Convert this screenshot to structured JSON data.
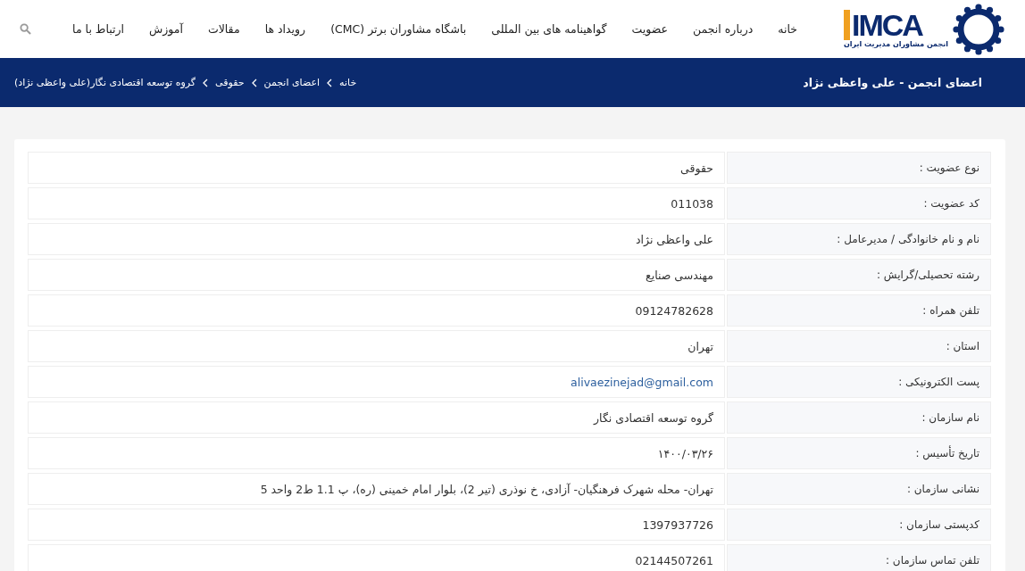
{
  "logo": {
    "mark": "IMCA",
    "subtitle": "انجمن مشاوران مدیریت ایران"
  },
  "nav": [
    "خانه",
    "درباره انجمن",
    "عضویت",
    "گواهینامه های بین المللی",
    "باشگاه مشاوران برتر (CMC)",
    "رویداد ها",
    "مقالات",
    "آموزش",
    "ارتباط با ما"
  ],
  "page_title": "اعضای انجمن - علی واعظی نژاد",
  "breadcrumb": [
    "خانه",
    "اعضای انجمن",
    "حقوقی",
    "گروه توسعه اقتصادی نگار(علی واعظی نژاد)"
  ],
  "rows": [
    {
      "label": "نوع عضویت :",
      "value": "حقوقی",
      "kind": "text"
    },
    {
      "label": "کد عضویت :",
      "value": "011038",
      "kind": "text"
    },
    {
      "label": "نام و نام خانوادگی / مدیرعامل :",
      "value": "علی واعظی نژاد",
      "kind": "text"
    },
    {
      "label": "رشته تحصیلی/گرایش :",
      "value": "مهندسی صنایع",
      "kind": "text"
    },
    {
      "label": "تلفن همراه :",
      "value": "09124782628",
      "kind": "text"
    },
    {
      "label": "استان :",
      "value": "تهران",
      "kind": "text"
    },
    {
      "label": "پست الکترونیکی :",
      "value": "alivaezinejad@gmail.com",
      "kind": "email"
    },
    {
      "label": "نام سازمان :",
      "value": "گروه توسعه اقتصادی نگار",
      "kind": "text"
    },
    {
      "label": "تاریخ تأسیس :",
      "value": "۱۴۰۰/۰۳/۲۶",
      "kind": "text"
    },
    {
      "label": "نشانی سازمان :",
      "value": "تهران- محله شهرک فرهنگیان- آزادی، خ نوذری (تیر 2)، بلوار امام خمینی (ره)، پ 1.1 ط2 واحد 5",
      "kind": "text"
    },
    {
      "label": "کدپستی سازمان :",
      "value": "1397937726",
      "kind": "text"
    },
    {
      "label": "تلفن تماس سازمان :",
      "value": "02144507261",
      "kind": "text"
    }
  ]
}
